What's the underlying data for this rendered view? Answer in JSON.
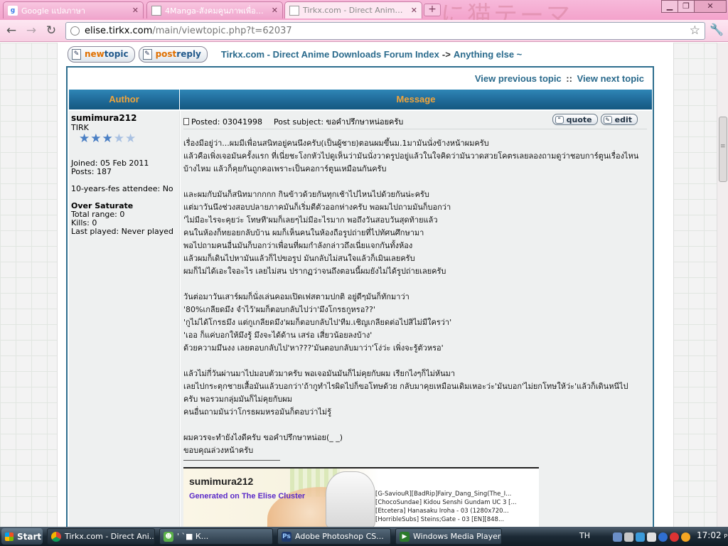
{
  "browser": {
    "tabs": [
      {
        "label": "Google แปลภาษา",
        "icon": "google-icon",
        "active": false
      },
      {
        "label": "4Manga-สังคมคูนภาพเพื่อค...",
        "icon": "page-icon",
        "active": false
      },
      {
        "label": "Tirkx.com - Direct Anime D...",
        "icon": "page-icon",
        "active": true
      }
    ],
    "url_host": "elise.tirkx.com",
    "url_rest": "/main/viewtopic.php?t=62037"
  },
  "forum": {
    "newtopic_label_a": "new",
    "newtopic_label_b": "topic",
    "postreply_label_a": "post",
    "postreply_label_b": "reply",
    "breadcrumb_index": "Tirkx.com - Direct Anime Downloads Forum Index",
    "breadcrumb_sep": "->",
    "breadcrumb_forum": "Anything else ~",
    "prev_topic": "View previous topic",
    "nav_sep": "::",
    "next_topic": "View next topic",
    "col_author": "Author",
    "col_message": "Message"
  },
  "author": {
    "name": "sumimura212",
    "rank": "TIRK",
    "stars_filled": 3,
    "stars_total": 5,
    "joined": "Joined: 05 Feb 2011",
    "posts": "Posts: 187",
    "attendee": "10-years-fes attendee: No",
    "game_title": "Over Saturate",
    "total_range": "Total range: 0",
    "kills": "Kills: 0",
    "last_played": "Last played: Never played"
  },
  "post": {
    "posted": "Posted: 03041998",
    "subject": "Post subject: ขอคำปรึกษาหน่อยครับ",
    "quote_label": "quote",
    "edit_label": "edit",
    "paragraphs": [
      [
        "เรื่องมีอยู่ว่า...ผมมีเพื่อนสนิทอยู่คนนึงครับ(เป็นผู้ชาย)ตอนผมขึ้นม.1มามันนั่งข้างหน้าผมครับ",
        "แล้วคือเพิ่งเจอมันครั้งแรก ที่เนี่ยชะโงกหัวไปดูเห็นว่ามันนั่งวาดรูปอยู่แล้วในใจคิดว่ามันวาดสวยโคตรเลยลองถามดูว่าชอบการ์ตูนเรื่องไหน",
        "บ้างไหม แล้วก็คุยกันถูกคอเพราะเป็นคอการ์ตูนเหมือนกันครับ"
      ],
      [
        "และผมกับมันก็สนิทมากกกก กินข้าวด้วยกันทุกเช้าไปไหนไปด้วยกันน่ะครับ",
        "แต่มาวันนึงช่วงสอบปลายภาคมันก็เริ่มตีตัวออกห่างครับ พอผมไปถามมันก็บอกว่า",
        "'ไม่มีอะไรจะคุยว่ะ โทษที'ผมก็เลยๆไม่มีอะไรมาก พอถึงวันสอบวันสุดท้ายแล้ว",
        "คนในห้องก็ทยอยกลับบ้าน ผมก็เห็นคนในห้องถือรูปถ่ายที่ไปทัศนศึกษามา",
        "พอไปถามคนอื่นมันก็บอกว่าเพื่อนที่ผมกำลังกล่าวถึงเนี่ยแจกกันทั้งห้อง",
        "แล้วผมก็เดินไปหามันแล้วก็ไปขอรูป มันกลับไม่สนใจแล้วก็เมินเลยครับ",
        "ผมก็ไม่ได้เอะใจอะไร เลยไม่สน ปรากฏว่าจนถึงตอนนี้ผมยังไม่ได้รูปถ่ายเลยครับ"
      ],
      [
        "วันต่อมาวันเสาร์ผมก็นั่งเล่นคอมเปิดเฟสตามปกติ อยู่ดีๆมันก็ทักมาว่า",
        "'80%เกลียดมึง จำไว้'ผมก็ตอบกลับไปว่า'มึงโกรธกูหรอ??'",
        "'กูไม่ได้โกรธมึง แต่กูเกลียดมึง'ผมก็ตอบกลับไป'ทีม.เชิญเกลียดต่อไปสิไม่มีใครว่า'",
        "'เออ ก็แค่บอกให้มึงรู้ มึงจะได้ด้าน เสร่อ เสี่ยวน้อยลงบ้าง'",
        "ด้วยความมึนงง เลยตอบกลับไป'หา???'มันตอบกลับมาว่า'โง่ว่ะ เพิ่งจะรู้ตัวหรอ'"
      ],
      [
        "แล้วไม่กี่วันผ่านมาไปมอบตัวมาครับ พอเจอมันมันก็ไม่คุยกับผม เรียกไงๆก็ไม่หันมา",
        "เลยไปกระตุกชายเสื้อมันแล้วบอกว่า'ถ้ากูทำไรผิดไปก็ขอโทษด้วย กลับมาคุยเหมือนเดิมเหอะว่ะ'มันบอก'ไม่ยกโทษให้ว่ะ'แล้วก็เดินหนีไป",
        "ครับ พอรวมกลุ่มมันก็ไม่คุยกับผม",
        "คนอื่นถามมันว่าโกรธผมหรอมันก็ตอบว่าไม่รู้"
      ],
      [
        "ผมควรจะทำยังไงดีครับ ขอคำปรึกษาหน่อย(_ _)",
        "ขอบคุณล่วงหน้าครับ"
      ]
    ]
  },
  "signature": {
    "name": "sumimura212",
    "generated": "Generated on The Elise Cluster",
    "downloads": [
      "[G-SaviouR][BadRip]Fairy_Dang_Sing(The_I...",
      "[ChocoSundae] Kidou Senshi Gundam UC 3 [...",
      "[Etcetera] Hanasaku Iroha - 03 (1280x720...",
      "[HorribleSubs] Steins;Gate - 03 [EN][848..."
    ]
  },
  "taskbar": {
    "start_label": "Start",
    "tasks": [
      {
        "label": "Tirkx.com - Direct Ani...",
        "icon": "chrome-icon",
        "active": true
      },
      {
        "label": "'        `■ К...",
        "icon": "messenger-icon",
        "active": false
      },
      {
        "label": "Adobe Photoshop CS...",
        "icon": "photoshop-icon",
        "active": false
      },
      {
        "label": "Windows Media Player",
        "icon": "media-player-icon",
        "active": false
      }
    ],
    "language": "TH",
    "time": "17:02",
    "ampm": "PM"
  }
}
